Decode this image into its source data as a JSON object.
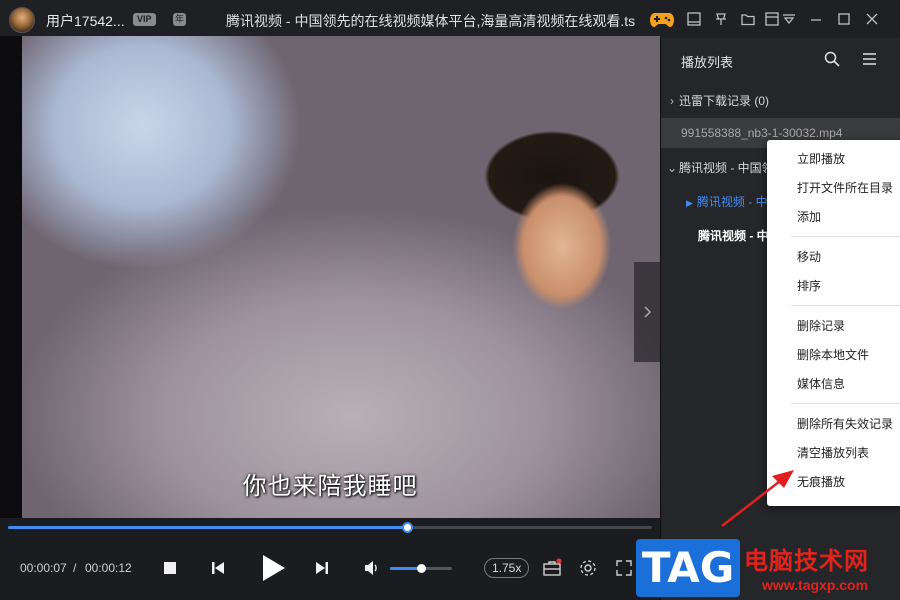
{
  "titlebar": {
    "username": "用户17542...",
    "vip_badge": "VIP",
    "year_badge": "年",
    "window_title": "腾讯视频 - 中国领先的在线视频媒体平台,海量高清视频在线观看.ts"
  },
  "video": {
    "subtitle": "你也来陪我睡吧"
  },
  "player": {
    "progress_fraction": 0.62,
    "current_time": "00:00:07",
    "separator": "/",
    "total_time": "00:00:12",
    "volume_fraction": 0.5,
    "speed": "1.75x",
    "accent_color": "#3f8cf0"
  },
  "playlist": {
    "title": "播放列表",
    "rows": [
      {
        "label": "迅雷下载记录 (0)"
      },
      {
        "label": "991558388_nb3-1-30032.mp4"
      },
      {
        "label": "腾讯视频 - 中国领"
      },
      {
        "label": "腾讯视频 - 中"
      },
      {
        "label": "腾讯视频 - 中"
      }
    ]
  },
  "context_menu": {
    "items": [
      "立即播放",
      "打开文件所在目录",
      "添加",
      "移动",
      "排序",
      "删除记录",
      "删除本地文件",
      "媒体信息",
      "删除所有失效记录",
      "清空播放列表",
      "无痕播放"
    ]
  },
  "watermark": {
    "tag": "TAG",
    "site_name": "电脑技术网",
    "url": "www.tagxp.com",
    "color": "#e0241c"
  }
}
